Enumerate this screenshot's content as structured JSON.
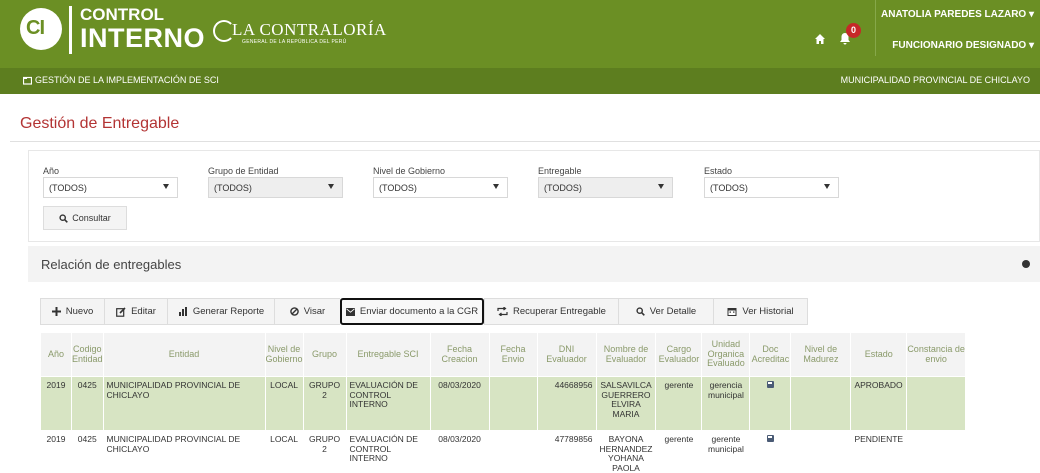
{
  "header": {
    "logo_line1": "CONTROL",
    "logo_line2": "INTERNO",
    "contraloria_name": "LA CONTRALORÍA",
    "contraloria_sub": "GENERAL DE LA REPÚBLICA DEL PERÚ",
    "notification_count": "0",
    "user_name": "ANATOLIA PAREDES LAZARO ▾",
    "user_role": "FUNCIONARIO DESIGNADO ▾"
  },
  "subbar": {
    "module": "GESTIÓN DE LA IMPLEMENTACIÓN DE SCI",
    "entity": "MUNICIPALIDAD PROVINCIAL DE CHICLAYO"
  },
  "page_title": "Gestión de Entregable",
  "filters": {
    "anio": {
      "label": "Año",
      "value": "(TODOS)"
    },
    "grupo": {
      "label": "Grupo de Entidad",
      "value": "(TODOS)"
    },
    "nivel": {
      "label": "Nivel de Gobierno",
      "value": "(TODOS)"
    },
    "entregable": {
      "label": "Entregable",
      "value": "(TODOS)"
    },
    "estado": {
      "label": "Estado",
      "value": "(TODOS)"
    },
    "consultar_label": "Consultar"
  },
  "relacion_title": "Relación de entregables",
  "toolbar": {
    "nuevo": "Nuevo",
    "editar": "Editar",
    "generar": "Generar Reporte",
    "visar": "Visar",
    "enviar": "Enviar documento a la CGR",
    "recuperar": "Recuperar Entregable",
    "ver_detalle": "Ver Detalle",
    "ver_historial": "Ver Historial"
  },
  "table": {
    "headers": [
      "Año",
      "Codigo Entidad",
      "Entidad",
      "Nivel de Gobierno",
      "Grupo",
      "Entregable SCI",
      "Fecha Creacion",
      "Fecha Envio",
      "DNI Evaluador",
      "Nombre de Evaluador",
      "Cargo Evaluador",
      "Unidad Organica Evaluado",
      "Doc Acreditac",
      "Nivel de Madurez",
      "Estado",
      "Constancia de envio"
    ],
    "rows": [
      {
        "anio": "2019",
        "codigo": "0425",
        "entidad": "MUNICIPALIDAD PROVINCIAL DE CHICLAYO",
        "nivel": "LOCAL",
        "grupo": "GRUPO 2",
        "entregable": "EVALUACIÓN DE CONTROL INTERNO",
        "fecha_creacion": "08/03/2020",
        "fecha_envio": "",
        "dni": "44668956",
        "nombre": "SALSAVILCA GUERRERO ELVIRA MARIA",
        "cargo": "gerente",
        "unidad": "gerencia municipal",
        "madurez": "",
        "estado": "APROBADO",
        "constancia": ""
      },
      {
        "anio": "2019",
        "codigo": "0425",
        "entidad": "MUNICIPALIDAD PROVINCIAL DE CHICLAYO",
        "nivel": "LOCAL",
        "grupo": "GRUPO 2",
        "entregable": "EVALUACIÓN DE CONTROL INTERNO",
        "fecha_creacion": "08/03/2020",
        "fecha_envio": "",
        "dni": "47789856",
        "nombre": "BAYONA HERNANDEZ YOHANA PAOLA",
        "cargo": "gerente",
        "unidad": "gerente municipal",
        "madurez": "",
        "estado": "PENDIENTE",
        "constancia": ""
      }
    ]
  },
  "colors": {
    "header_green": "#6b8f24",
    "subbar_green": "#5d7e1f",
    "title_red": "#b33434",
    "selected_row": "#d7e4c3"
  }
}
